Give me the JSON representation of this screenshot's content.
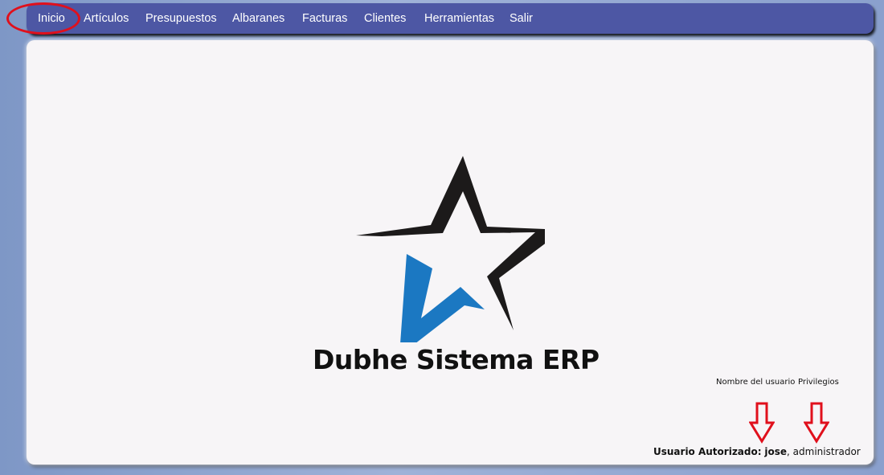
{
  "nav": {
    "items": [
      "Inicio",
      "Artículos",
      "Presupuestos",
      "Albaranes",
      "Facturas",
      "Clientes",
      "Herramientas",
      "Salir"
    ]
  },
  "brand": {
    "name": "Dubhe Sistema ERP",
    "star_colors": {
      "dark": "#1c1a1a",
      "blue": "#1b78c2"
    }
  },
  "annotations": {
    "username_label": "Nombre del usuario",
    "privileges_label": "Privilegios",
    "arrow_color": "#e0101c"
  },
  "user_status": {
    "prefix": "Usuario Autorizado:",
    "username": "jose",
    "separator": ",",
    "role": "administrador"
  }
}
